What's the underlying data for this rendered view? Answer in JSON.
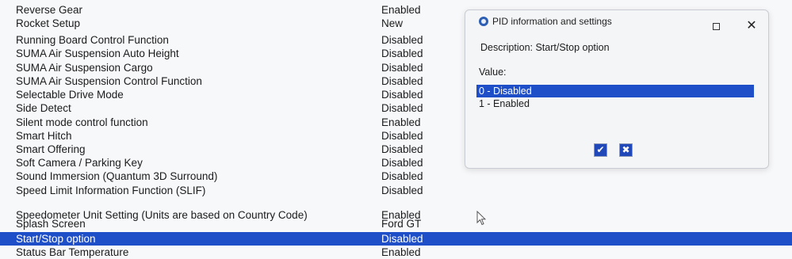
{
  "rows": [
    {
      "name": "Reverse Gear",
      "value": "Enabled"
    },
    {
      "name": "Rocket Setup",
      "value": "New"
    },
    {
      "name": "Running Board Control Function",
      "value": "Disabled"
    },
    {
      "name": "SUMA Air Suspension Auto Height",
      "value": "Disabled"
    },
    {
      "name": "SUMA Air Suspension Cargo",
      "value": "Disabled"
    },
    {
      "name": "SUMA Air Suspension Control Function",
      "value": "Disabled"
    },
    {
      "name": "Selectable Drive Mode",
      "value": "Disabled"
    },
    {
      "name": "Side Detect",
      "value": "Disabled"
    },
    {
      "name": "Silent mode control function",
      "value": "Enabled"
    },
    {
      "name": "Smart Hitch",
      "value": "Disabled"
    },
    {
      "name": "Smart Offering",
      "value": "Disabled"
    },
    {
      "name": "Soft Camera / Parking Key",
      "value": "Disabled"
    },
    {
      "name": "Sound Immersion (Quantum 3D Surround)",
      "value": "Disabled"
    },
    {
      "name": "Speed Limit Information Function (SLIF)",
      "value": "Disabled"
    },
    {
      "name": "Speedometer Unit Setting (Units are based on Country Code)",
      "value": "Enabled"
    },
    {
      "name": "Splash Screen",
      "value": "Ford GT"
    },
    {
      "name": "Start/Stop option",
      "value": "Disabled",
      "selected": true
    },
    {
      "name": "Status Bar Temperature",
      "value": "Enabled"
    }
  ],
  "dialog": {
    "title": "PID information and settings",
    "description": "Description: Start/Stop option",
    "value_label": "Value:",
    "options": [
      {
        "label": "0 - Disabled",
        "selected": true
      },
      {
        "label": "1 - Enabled",
        "selected": false
      }
    ],
    "close_glyph": "✕",
    "ok_glyph": "✔",
    "cancel_glyph": "✖"
  },
  "colors": {
    "selection": "#1f4fc8",
    "background": "#f7f8fa",
    "dialog_background": "#f4f5f7"
  }
}
